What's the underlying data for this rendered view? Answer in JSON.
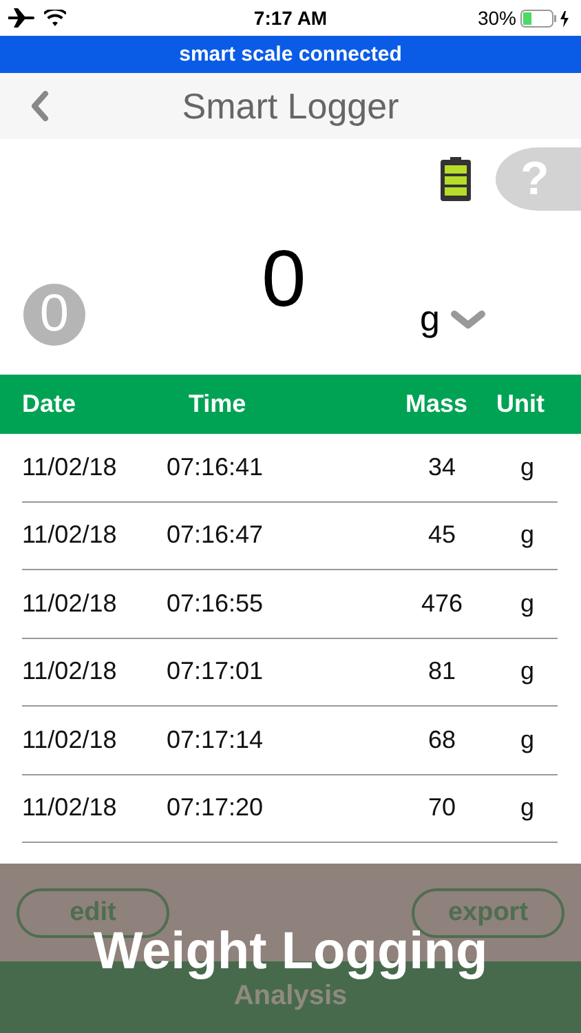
{
  "status_bar": {
    "time": "7:17 AM",
    "battery": "30%"
  },
  "banner": {
    "text": "smart scale connected"
  },
  "nav": {
    "title": "Smart Logger"
  },
  "help_button": {
    "label": "?"
  },
  "tare_button": {
    "label": "0"
  },
  "reading": {
    "value": "0",
    "unit": "g"
  },
  "table": {
    "columns": [
      "Date",
      "Time",
      "Mass",
      "Unit"
    ],
    "rows": [
      {
        "date": "11/02/18",
        "time": "07:16:41",
        "mass": "34",
        "unit": "g"
      },
      {
        "date": "11/02/18",
        "time": "07:16:47",
        "mass": "45",
        "unit": "g"
      },
      {
        "date": "11/02/18",
        "time": "07:16:55",
        "mass": "476",
        "unit": "g"
      },
      {
        "date": "11/02/18",
        "time": "07:17:01",
        "mass": "81",
        "unit": "g"
      },
      {
        "date": "11/02/18",
        "time": "07:17:14",
        "mass": "68",
        "unit": "g"
      },
      {
        "date": "11/02/18",
        "time": "07:17:20",
        "mass": "70",
        "unit": "g"
      }
    ]
  },
  "buttons": [
    "edit",
    "export"
  ],
  "tab": {
    "label": "Analysis"
  },
  "caption": "Weight Logging"
}
